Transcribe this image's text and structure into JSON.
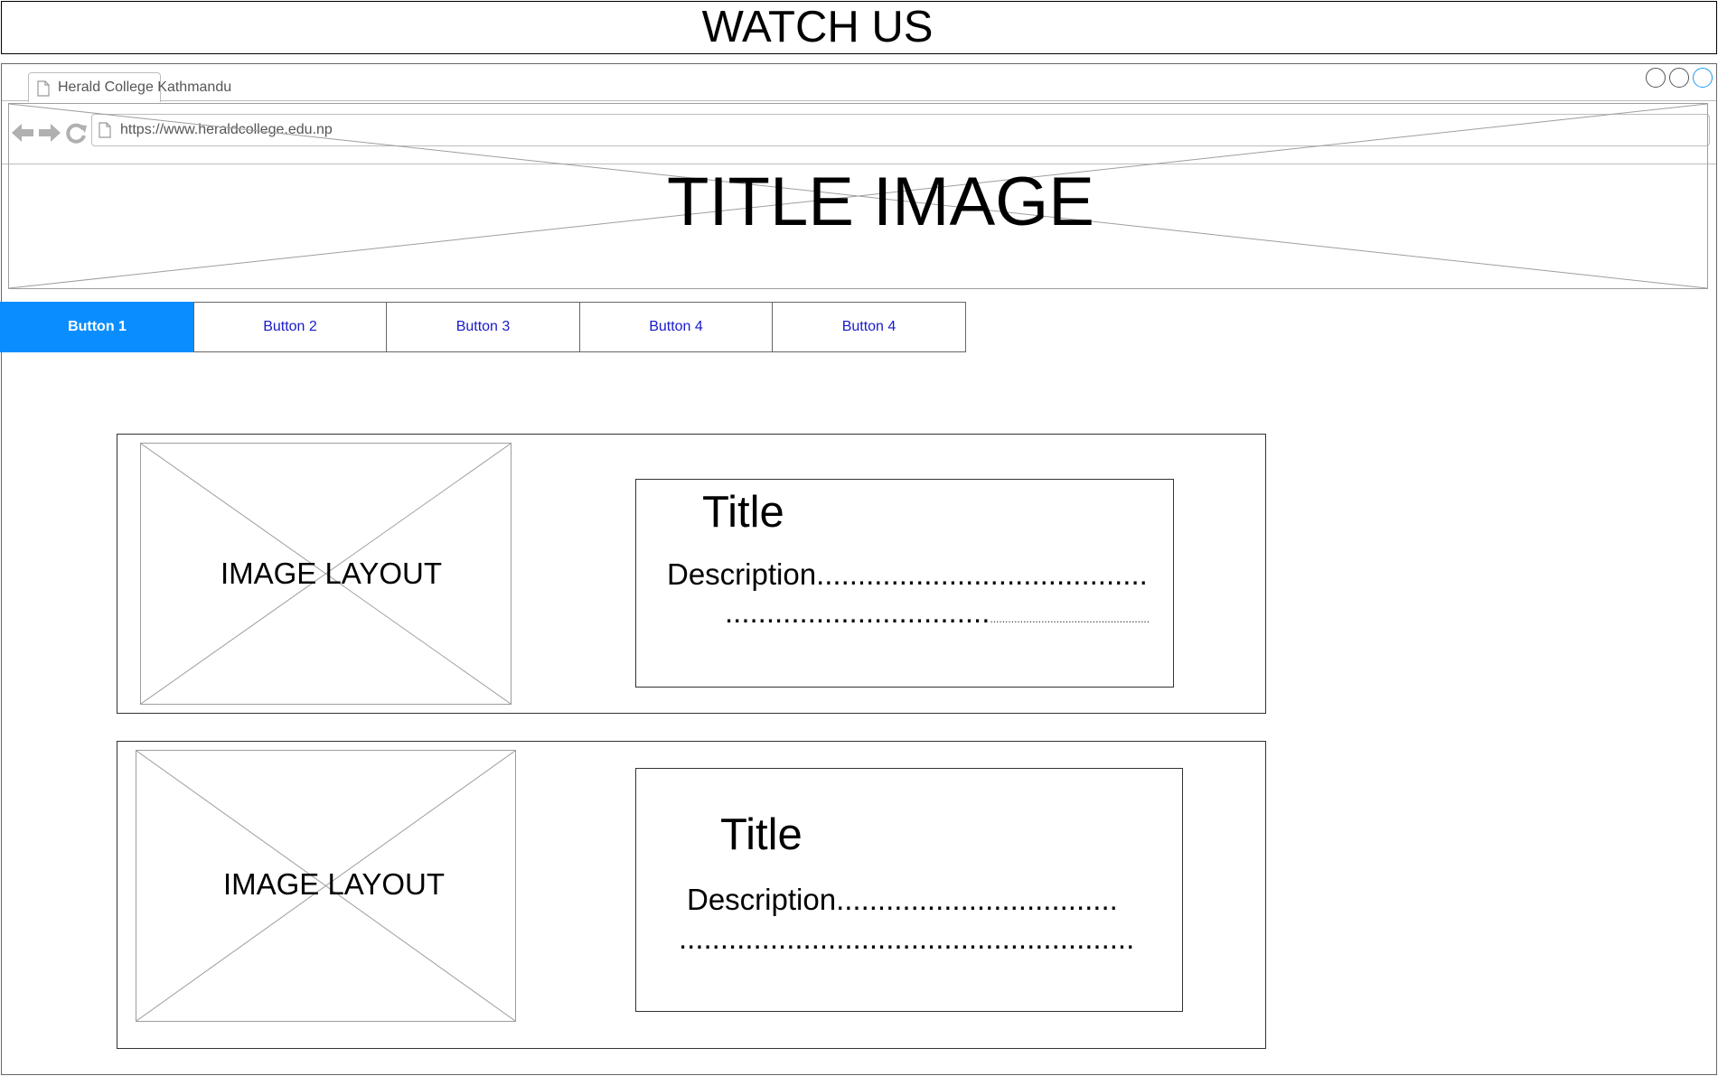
{
  "banner": {
    "title": "WATCH US"
  },
  "browser": {
    "tab": {
      "label": "Herald College Kathmandu",
      "icon": "document-icon"
    },
    "window_controls": [
      "minimize-icon",
      "maximize-icon",
      "close-icon"
    ],
    "nav": {
      "back_icon": "back-arrow-icon",
      "forward_icon": "forward-arrow-icon",
      "reload_icon": "reload-icon"
    },
    "url": "https://www.heraldcollege.edu.np"
  },
  "hero": {
    "title": "TITLE IMAGE"
  },
  "menu": {
    "accent_color": "#0a8eff",
    "link_color": "#1a1acc",
    "buttons": [
      {
        "label": "Button 1",
        "active": true
      },
      {
        "label": "Button 2",
        "active": false
      },
      {
        "label": "Button 3",
        "active": false
      },
      {
        "label": "Button 4",
        "active": false
      },
      {
        "label": "Button 4",
        "active": false
      }
    ]
  },
  "cards": [
    {
      "image_label": "IMAGE LAYOUT",
      "title": "Title",
      "description": "Description........................................",
      "dots_line": "................................",
      "dots_tail": "....................................................."
    },
    {
      "image_label": "IMAGE LAYOUT",
      "title": "Title",
      "description": "Description..................................",
      "dots_line": "......................................................."
    }
  ]
}
